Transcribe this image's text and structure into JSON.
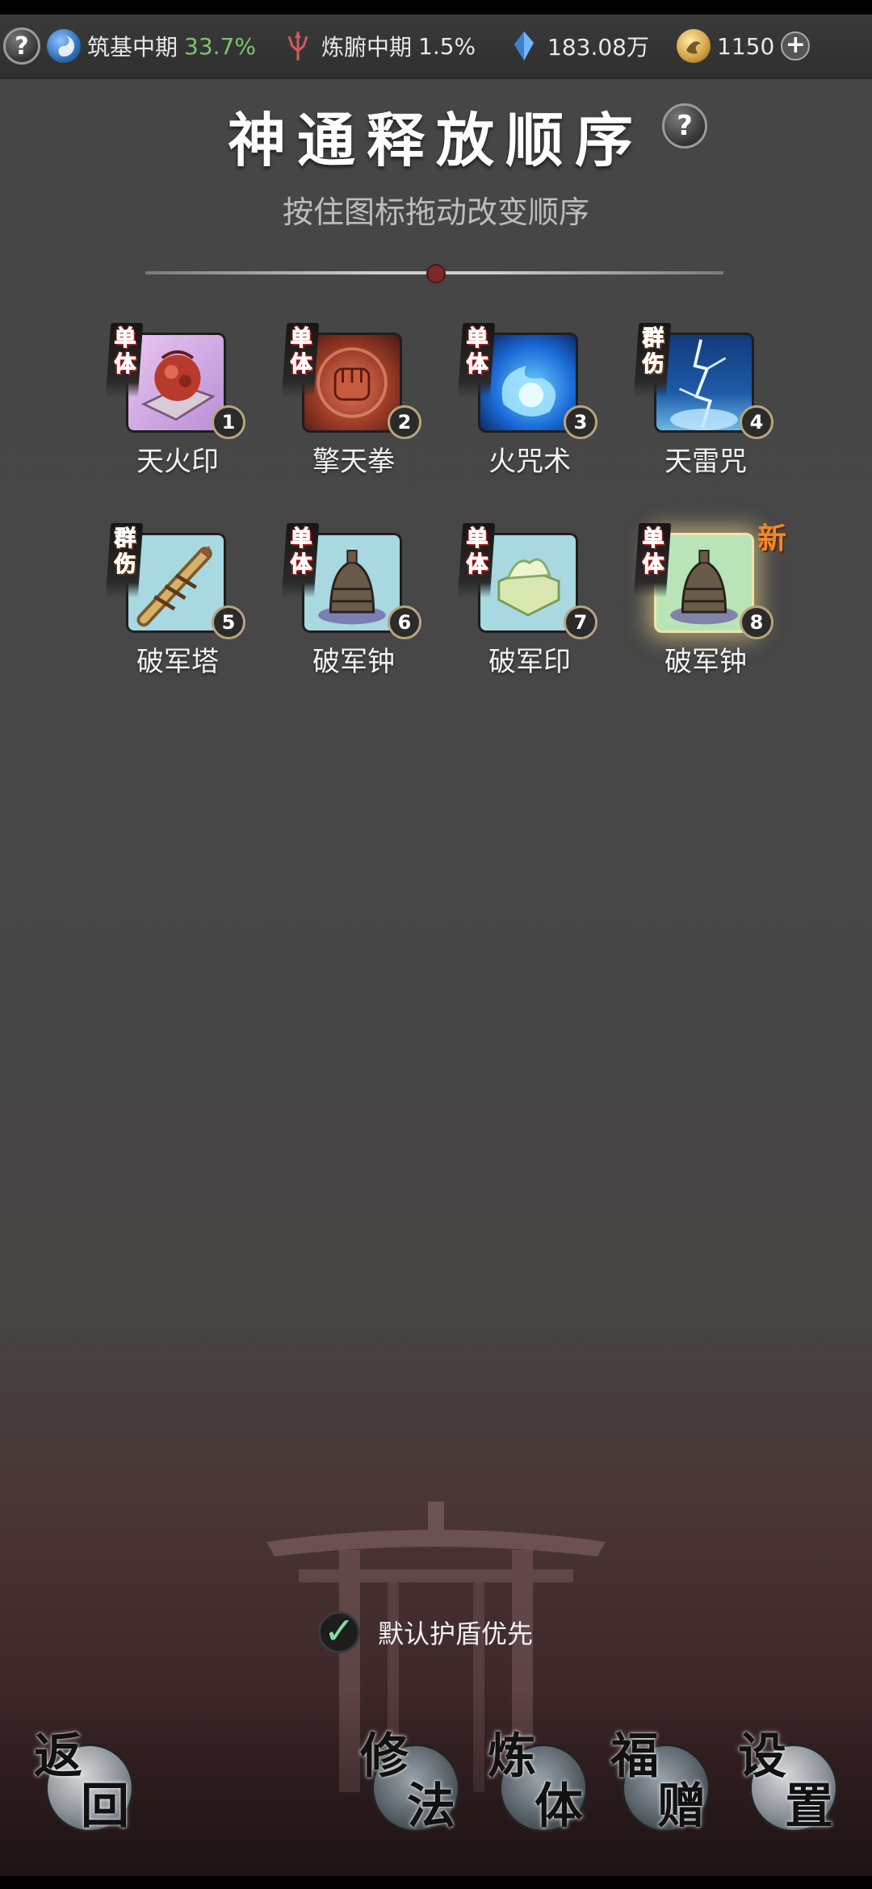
{
  "status_bar": {
    "realm": {
      "name": "筑基中期",
      "percent": "33.7%"
    },
    "body_realm": {
      "name": "炼腑中期",
      "percent": "1.5%"
    },
    "crystal": {
      "amount": "183.08万"
    },
    "coin": {
      "amount": "1150"
    }
  },
  "page": {
    "title": "神通释放顺序",
    "subtitle": "按住图标拖动改变顺序"
  },
  "skills": [
    {
      "name": "天火印",
      "tag": "单体",
      "order": "1"
    },
    {
      "name": "擎天拳",
      "tag": "单体",
      "order": "2"
    },
    {
      "name": "火咒术",
      "tag": "单体",
      "order": "3"
    },
    {
      "name": "天雷咒",
      "tag": "群伤",
      "order": "4"
    },
    {
      "name": "破军塔",
      "tag": "群伤",
      "order": "5"
    },
    {
      "name": "破军钟",
      "tag": "单体",
      "order": "6"
    },
    {
      "name": "破军印",
      "tag": "单体",
      "order": "7"
    },
    {
      "name": "破军钟",
      "tag": "单体",
      "order": "8",
      "new_label": "新"
    }
  ],
  "shield_option": {
    "label": "默认护盾优先",
    "checked": true
  },
  "nav": {
    "back": [
      "返",
      "回"
    ],
    "cultivate": [
      "修",
      "法"
    ],
    "refine": [
      "炼",
      "体"
    ],
    "gift": [
      "福",
      "赠"
    ],
    "settings": [
      "设",
      "置"
    ]
  },
  "help_symbol": "?"
}
